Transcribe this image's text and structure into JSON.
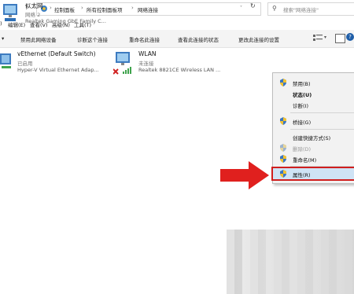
{
  "address_bar": {
    "crumbs": [
      "控制面板",
      "所有控制面板项",
      "网络连接"
    ],
    "search_placeholder": "搜索\"网络连接\""
  },
  "menu": [
    "编辑(E)",
    "查看(V)",
    "高级(N)",
    "工具(T)"
  ],
  "commands": [
    "禁用此网络设备",
    "诊断这个连接",
    "重命名此连接",
    "查看此连接的状态",
    "更改此连接的设置"
  ],
  "adapters": [
    {
      "name": "vEthernet (Default Switch)",
      "status": "已启用",
      "device": "Hyper-V Virtual Ethernet Adap..."
    },
    {
      "name": "WLAN",
      "status": "未连接",
      "device": "Realtek 8821CE Wireless LAN ..."
    },
    {
      "name": "以太网",
      "status": "网络 2",
      "device": "Realtek Gaming GbE Family C..."
    }
  ],
  "context_menu": {
    "disable": "禁用(B)",
    "status": "状态(U)",
    "diagnose": "诊断(I)",
    "bridge": "桥接(G)",
    "create_shortcut": "创建快捷方式(S)",
    "delete": "删除(D)",
    "rename": "重命名(M)",
    "properties": "属性(R)"
  },
  "colors": {
    "selection": "#cde4f7",
    "arrow_red": "#e0201e",
    "highlight_border": "#d01e1e"
  }
}
